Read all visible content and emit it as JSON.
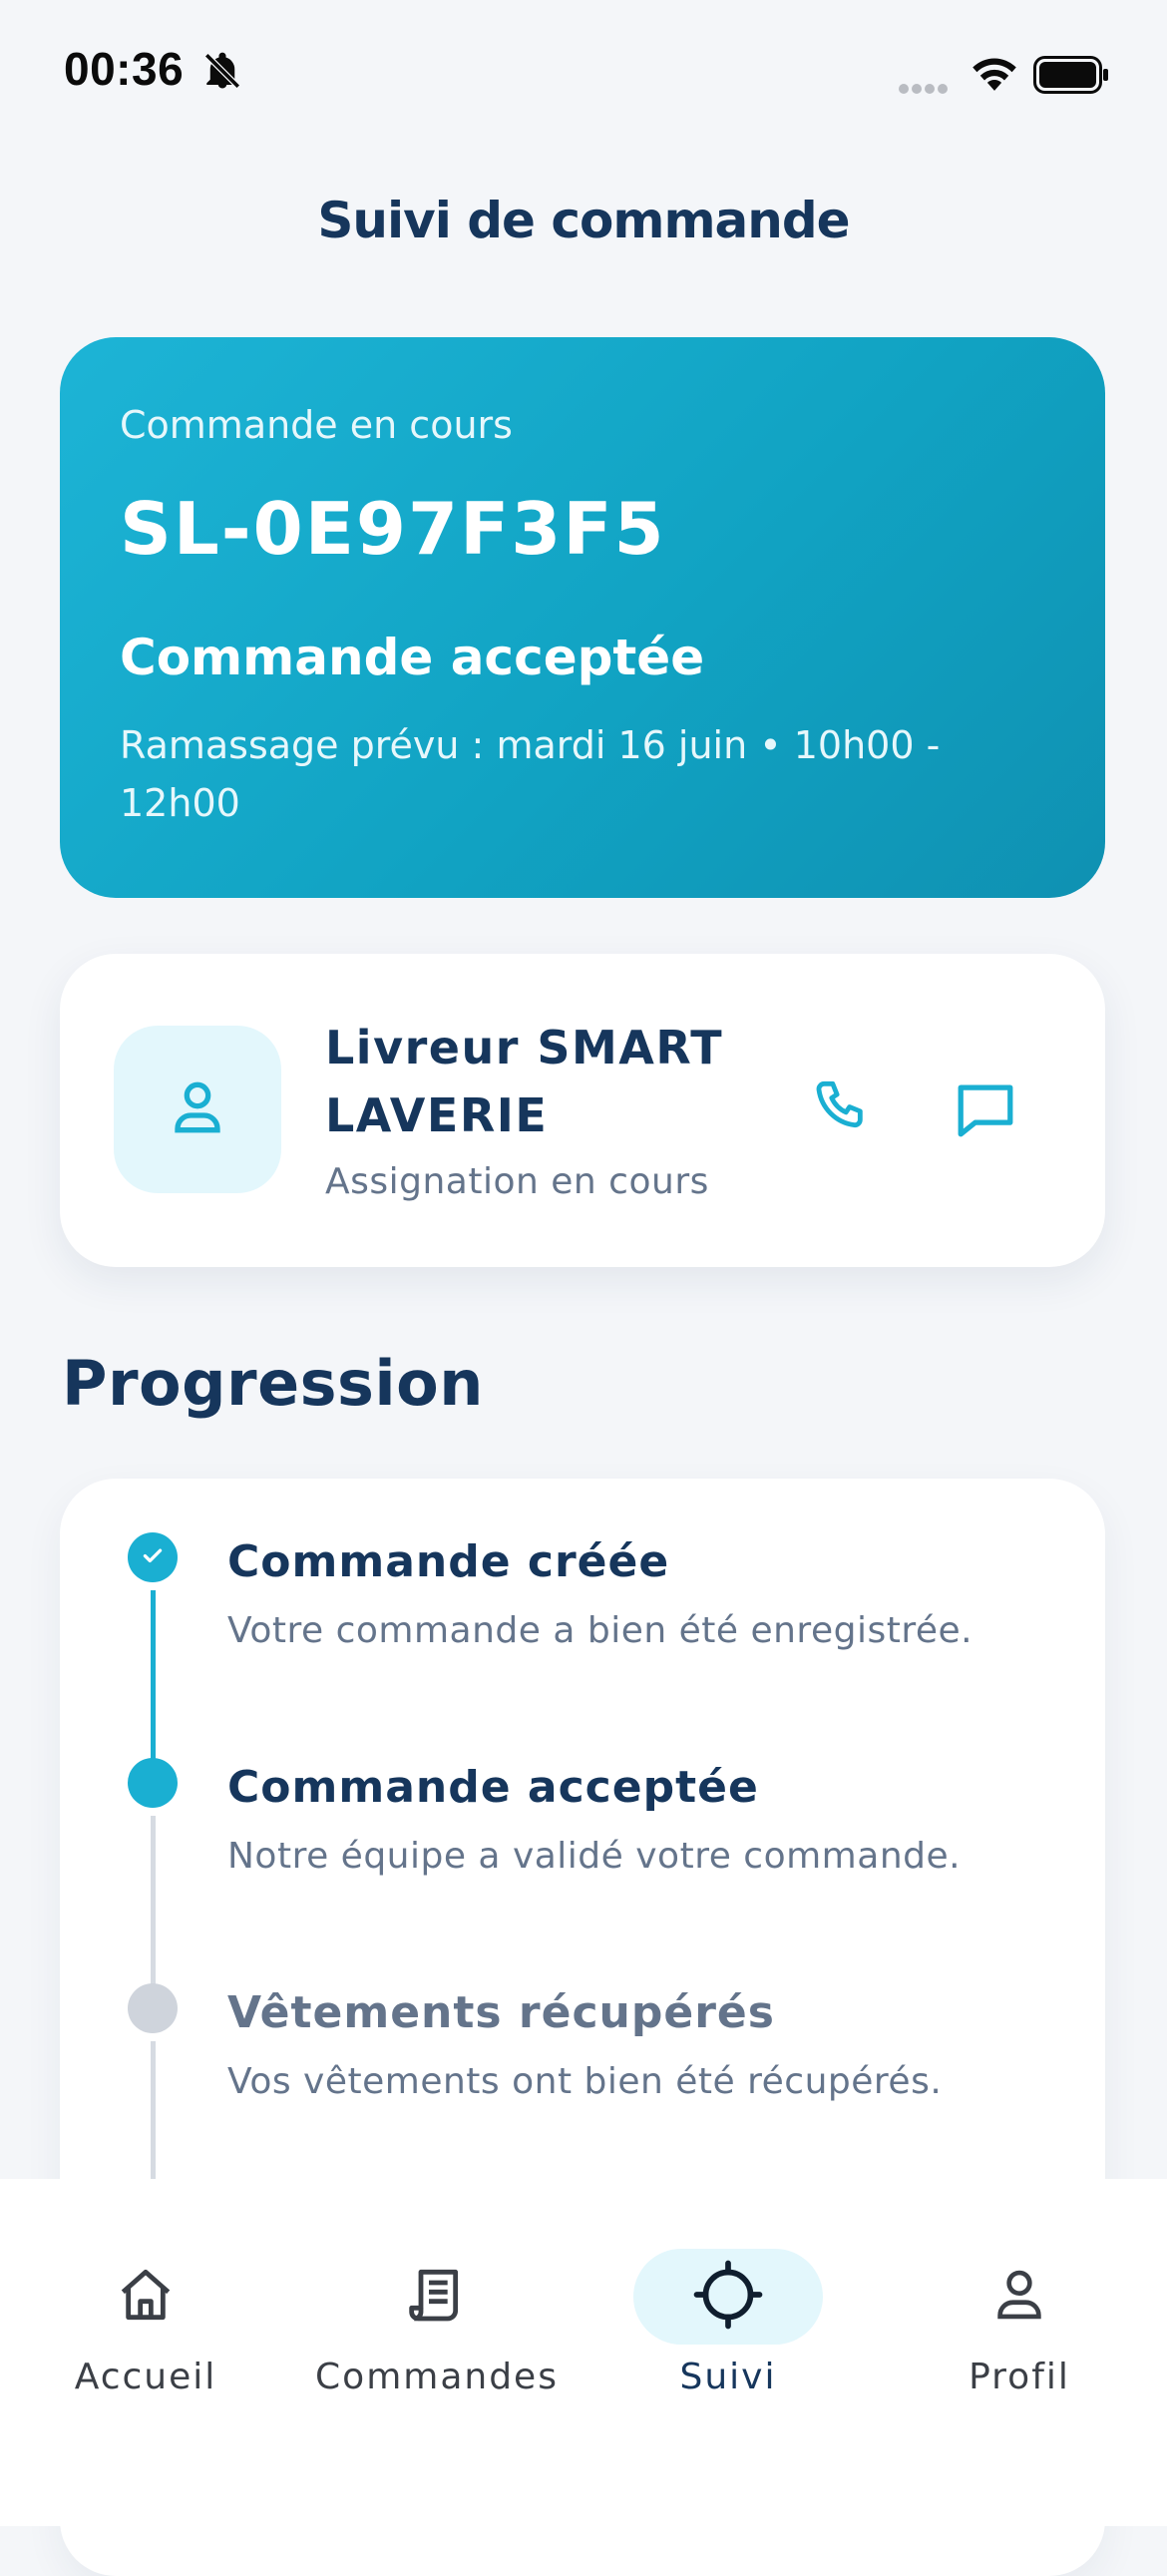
{
  "status_bar": {
    "time": "00:36"
  },
  "header": {
    "title": "Suivi de commande"
  },
  "order": {
    "label": "Commande en cours",
    "id": "SL-0E97F3F5",
    "status": "Commande acceptée",
    "pickup": "Ramassage prévu : mardi 16 juin • 10h00 - 12h00"
  },
  "driver": {
    "name": "Livreur SMART LAVERIE",
    "subtitle": "Assignation en cours",
    "avatar_icon": "person-icon",
    "call_icon": "phone-icon",
    "message_icon": "message-icon"
  },
  "progress": {
    "title": "Progression",
    "steps": [
      {
        "title": "Commande créée",
        "description": "Votre commande a bien été enregistrée.",
        "state": "completed"
      },
      {
        "title": "Commande acceptée",
        "description": "Notre équipe a validé votre commande.",
        "state": "current"
      },
      {
        "title": "Vêtements récupérés",
        "description": "Vos vêtements ont bien été récupérés.",
        "state": "pending"
      }
    ]
  },
  "tabs": [
    {
      "label": "Accueil",
      "icon": "home-icon",
      "active": false
    },
    {
      "label": "Commandes",
      "icon": "receipt-icon",
      "active": false
    },
    {
      "label": "Suivi",
      "icon": "crosshair-icon",
      "active": true
    },
    {
      "label": "Profil",
      "icon": "person-icon",
      "active": false
    }
  ],
  "colors": {
    "accent": "#1aafd2",
    "navy": "#16365c",
    "muted": "#64748b",
    "pending": "#cfd4dc"
  }
}
